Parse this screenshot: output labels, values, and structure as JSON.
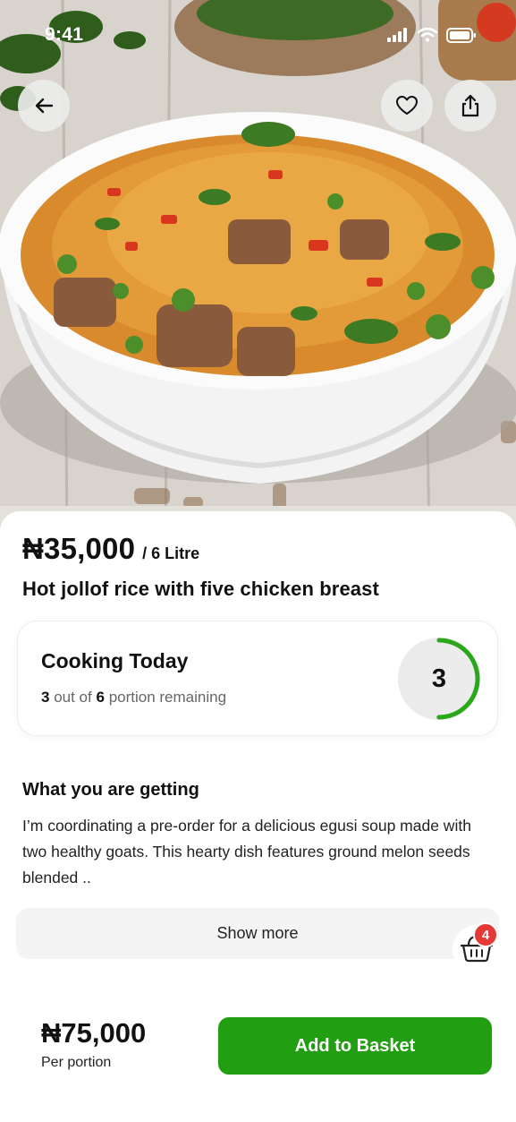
{
  "status_bar": {
    "time": "9:41"
  },
  "hero": {
    "back_icon": "arrow-left-icon",
    "favorite_icon": "heart-icon",
    "share_icon": "share-icon"
  },
  "product": {
    "price": "₦35,000",
    "unit": "/ 6 Litre",
    "title": "Hot jollof rice with five chicken breast"
  },
  "cooking": {
    "title": "Cooking Today",
    "remaining": "3",
    "remaining_text_mid": "out of",
    "total": "6",
    "remaining_text_end": "portion remaining",
    "ring_value": "3",
    "ring_fraction": 0.5,
    "ring_color": "#2aa81a"
  },
  "details": {
    "heading": "What you are getting",
    "body": "I’m coordinating a pre-order for a delicious egusi soup made with two healthy goats. This hearty dish features ground melon seeds blended ..",
    "show_more": "Show more"
  },
  "basket": {
    "count": "4",
    "icon": "basket-icon",
    "badge_color": "#e53935"
  },
  "footer": {
    "price": "₦75,000",
    "price_label": "Per portion",
    "add_button": "Add to Basket",
    "accent": "#229e12"
  }
}
